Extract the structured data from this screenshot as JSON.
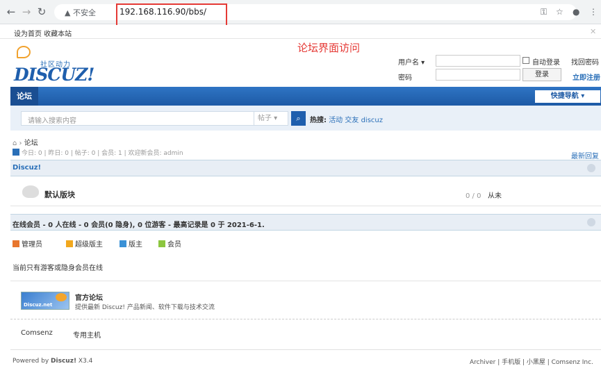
{
  "browser": {
    "security_label": "不安全",
    "url": "192.168.116.90/bbs/",
    "bookmarks": "设为首页 收藏本站"
  },
  "logo": {
    "subtitle": "社区动力",
    "brand": "DISCUZ!"
  },
  "annotation": "论坛界面访问",
  "login": {
    "username_label": "用户名",
    "password_label": "密码",
    "auto_login": "自动登录",
    "forgot": "找回密码",
    "login_button": "登录",
    "register": "立即注册"
  },
  "nav": {
    "tab": "论坛",
    "quick_nav": "快捷导航 ▾"
  },
  "search": {
    "placeholder": "请输入搜索内容",
    "type": "帖子",
    "hot_label": "热搜:",
    "hot_items": [
      "活动",
      "交友",
      "discuz"
    ]
  },
  "breadcrumb": "论坛",
  "stats": "今日: 0 | 昨日: 0 | 帖子: 0 | 会员: 1 | 欢迎新会员: admin",
  "latest_reply": "最新回复",
  "category": {
    "title": "Discuz!"
  },
  "forum": {
    "name": "默认版块",
    "counts": "0 / 0",
    "last_post": "从未"
  },
  "online": {
    "title": "在线会员 - 0 人在线 - 0 会员(0 隐身), 0 位游客 - 最高记录是 0 于 2021-6-1.",
    "legend": [
      "管理员",
      "超级版主",
      "版主",
      "会员"
    ],
    "legend_colors": [
      "#e8762d",
      "#f2a81e",
      "#3a91d6",
      "#8cc63f"
    ],
    "none_text": "当前只有游客或隐身会员在线"
  },
  "friend_link": {
    "logo_text": "Discuz.net",
    "title": "官方论坛",
    "description": "提供最新 Discuz! 产品新闻、软件下载与技术交流",
    "links": [
      "Comsenz",
      "专用主机"
    ]
  },
  "footer": {
    "powered": "Powered by",
    "powered_brand": "Discuz!",
    "version": "X3.4",
    "links": "Archiver | 手机版 | 小黑屋 | Comsenz Inc."
  }
}
